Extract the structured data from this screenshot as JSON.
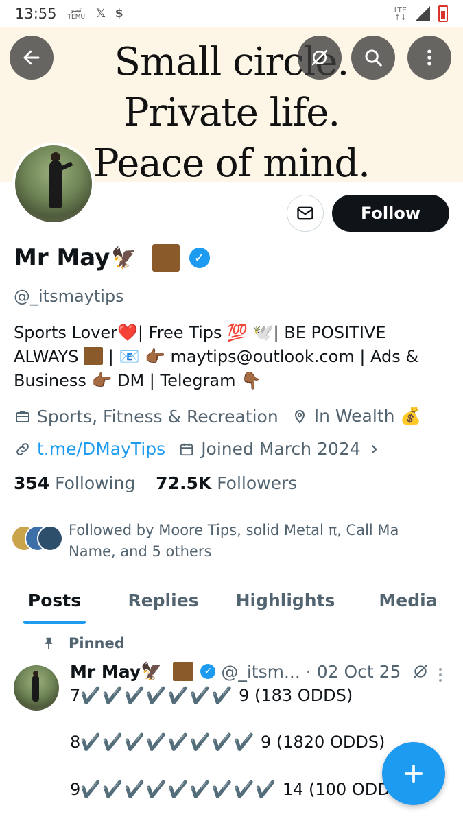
{
  "status_bar": {
    "time": "13:55",
    "notif_temu": "TEMU",
    "notif_x": "𝕏",
    "notif_dollar": "$",
    "network": "LTE"
  },
  "banner": {
    "line1": "Small circle.",
    "line2": "Private life.",
    "line3": "Peace of mind."
  },
  "icons": {
    "back": "back-arrow-icon",
    "grok": "grok-icon",
    "search": "search-icon",
    "more": "more-vertical-icon",
    "message": "envelope-icon",
    "category": "briefcase-icon",
    "location": "location-pin-icon",
    "link": "link-icon",
    "calendar": "calendar-icon",
    "pin": "pin-icon",
    "compose": "plus-icon"
  },
  "profile": {
    "follow_label": "Follow",
    "display_name": "Mr May",
    "name_emoji": "🦅",
    "handle": "@_itsmaytips",
    "bio_part1": "Sports Lover❤️| Free Tips 💯 🕊️| BE POSITIVE ALWAYS ",
    "bio_part2": " | 📧 👉🏾 maytips@outlook.com | Ads & Business 👉🏾 DM | Telegram 👇🏾",
    "category": "Sports, Fitness & Recreation",
    "location": "In Wealth 💰",
    "link": "t.me/DMayTips",
    "joined": "Joined March 2024",
    "joined_chevron": "›",
    "following_count": "354",
    "following_label": "Following",
    "followers_count": "72.5K",
    "followers_label": "Followers",
    "followed_by": "Followed by Moore Tips, solid Metal π, Call Ma Name, and 5 others"
  },
  "tabs": [
    {
      "label": "Posts"
    },
    {
      "label": "Replies"
    },
    {
      "label": "Highlights"
    },
    {
      "label": "Media"
    }
  ],
  "pinned_post": {
    "pinned_label": "Pinned",
    "author": "Mr May",
    "author_emoji": "🦅",
    "handle": "@_itsm...",
    "date": "· 02 Oct 25",
    "lines": [
      {
        "prefix": "7",
        "checks": "✔️✔️✔️✔️✔️✔️✔️",
        "suffix": " 9 (183 ODDS)"
      },
      {
        "prefix": "8",
        "checks": "✔️✔️✔️✔️✔️✔️✔️✔️",
        "suffix": " 9 (1820 ODDS)"
      },
      {
        "prefix": "9",
        "checks": "✔️✔️✔️✔️✔️✔️✔️✔️✔️",
        "suffix": " 14 (100 ODD"
      }
    ]
  },
  "colors": {
    "accent": "#1d9bf0",
    "text_primary": "#0f1419",
    "text_secondary": "#536471",
    "banner_bg": "#fdf6e6",
    "brown_square": "#8b5a2b"
  }
}
